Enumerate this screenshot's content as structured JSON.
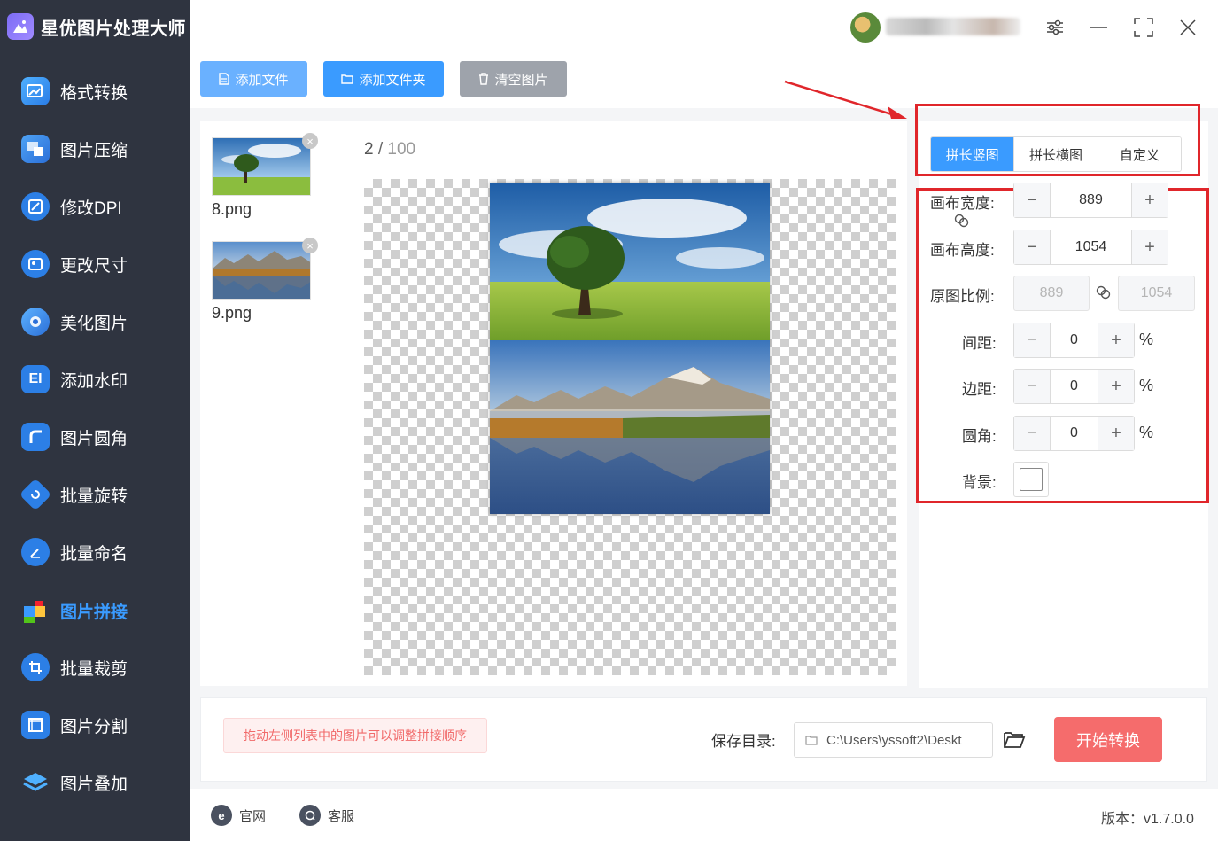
{
  "app": {
    "title": "星优图片处理大师"
  },
  "sidebar": {
    "items": [
      {
        "label": "格式转换",
        "icon": "image-convert-icon"
      },
      {
        "label": "图片压缩",
        "icon": "image-compress-icon"
      },
      {
        "label": "修改DPI",
        "icon": "dpi-icon"
      },
      {
        "label": "更改尺寸",
        "icon": "resize-icon"
      },
      {
        "label": "美化图片",
        "icon": "beautify-icon"
      },
      {
        "label": "添加水印",
        "icon": "watermark-icon"
      },
      {
        "label": "图片圆角",
        "icon": "round-corner-icon"
      },
      {
        "label": "批量旋转",
        "icon": "rotate-icon"
      },
      {
        "label": "批量命名",
        "icon": "rename-icon"
      },
      {
        "label": "图片拼接",
        "icon": "puzzle-icon",
        "active": true
      },
      {
        "label": "批量裁剪",
        "icon": "crop-icon"
      },
      {
        "label": "图片分割",
        "icon": "split-icon"
      },
      {
        "label": "图片叠加",
        "icon": "layers-icon"
      }
    ]
  },
  "toolbar": {
    "add_file": "添加文件",
    "add_folder": "添加文件夹",
    "clear_images": "清空图片"
  },
  "files": [
    {
      "name": "8.png"
    },
    {
      "name": "9.png"
    }
  ],
  "pagination": {
    "current": "2",
    "separator": " / ",
    "total": "100"
  },
  "settings": {
    "modes": [
      "拼长竖图",
      "拼长横图",
      "自定义"
    ],
    "active_mode": "拼长竖图",
    "canvas_width": {
      "label": "画布宽度:",
      "value": "889"
    },
    "canvas_height": {
      "label": "画布高度:",
      "value": "1054"
    },
    "original_ratio": {
      "label": "原图比例:",
      "width": "889",
      "height": "1054"
    },
    "spacing": {
      "label": "间距:",
      "value": "0",
      "unit": "%"
    },
    "margin": {
      "label": "边距:",
      "value": "0",
      "unit": "%"
    },
    "radius": {
      "label": "圆角:",
      "value": "0",
      "unit": "%"
    },
    "background": {
      "label": "背景:",
      "color": "#ffffff"
    }
  },
  "bottom": {
    "hint": "拖动左侧列表中的图片可以调整拼接顺序",
    "save_label": "保存目录:",
    "save_path": "C:\\Users\\yssoft2\\Deskt",
    "start_button": "开始转换"
  },
  "footer": {
    "official_site": "官网",
    "support": "客服",
    "version": "版本：v1.7.0.0"
  },
  "colors": {
    "accent": "#3a9bff",
    "sidebar_bg": "#2f3440",
    "danger": "#f56c6c",
    "annotation_red": "#e0262b"
  }
}
